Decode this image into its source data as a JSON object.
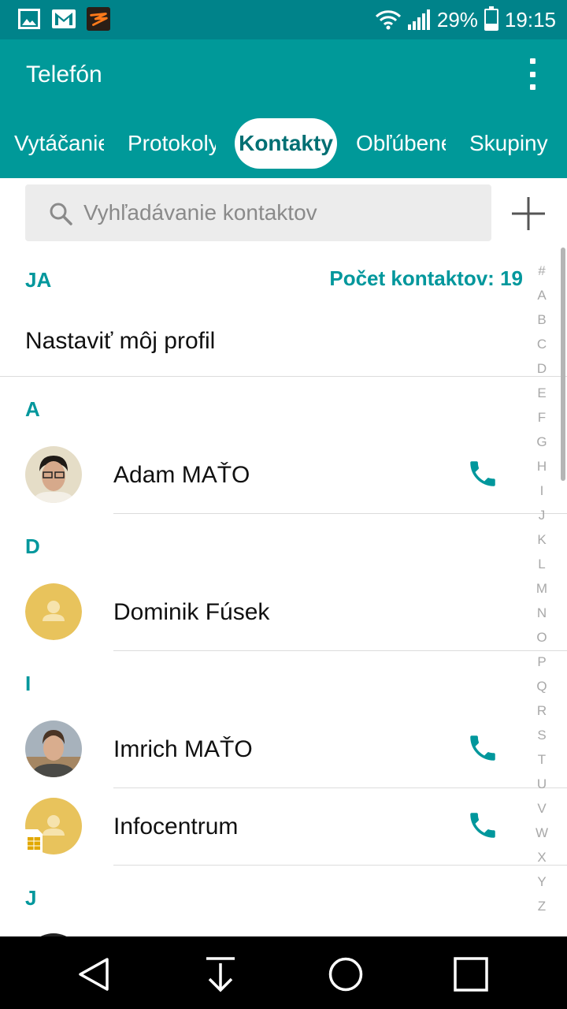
{
  "status_bar": {
    "battery_percent": "29%",
    "battery_level": 0.29,
    "time": "19:15",
    "icons": [
      "gallery-icon",
      "gmail-icon",
      "app-notification-icon",
      "wifi-icon",
      "signal-icon",
      "battery-icon"
    ]
  },
  "app_bar": {
    "title": "Telefón",
    "menu_icon": "more-vert-icon",
    "tabs": [
      {
        "label": "Vytáčanie",
        "active": false
      },
      {
        "label": "Protokoly",
        "active": false
      },
      {
        "label": "Kontakty",
        "active": true
      },
      {
        "label": "Obľúbené",
        "active": false
      },
      {
        "label": "Skupiny",
        "active": false
      }
    ]
  },
  "search": {
    "placeholder": "Vyhľadávanie kontaktov",
    "value": ""
  },
  "list": {
    "me_header": "JA",
    "contact_count": "Počet kontaktov: 19",
    "profile_label": "Nastaviť môj profil",
    "sections": [
      {
        "letter": "A",
        "contacts": [
          {
            "name": "Adam MAŤO",
            "avatar": "photo",
            "call": true
          }
        ]
      },
      {
        "letter": "D",
        "contacts": [
          {
            "name": "Dominik Fúsek",
            "avatar": "default",
            "call": false
          }
        ]
      },
      {
        "letter": "I",
        "contacts": [
          {
            "name": "Imrich MAŤO",
            "avatar": "photo",
            "call": true
          },
          {
            "name": "Infocentrum",
            "avatar": "default-sim",
            "call": true
          }
        ]
      },
      {
        "letter": "J",
        "contacts": []
      }
    ],
    "index_letters": [
      "#",
      "A",
      "B",
      "C",
      "D",
      "E",
      "F",
      "G",
      "H",
      "I",
      "J",
      "K",
      "L",
      "M",
      "N",
      "O",
      "P",
      "Q",
      "R",
      "S",
      "T",
      "U",
      "V",
      "W",
      "X",
      "Y",
      "Z"
    ]
  },
  "colors": {
    "status_bar": "#00838a",
    "app_bar": "#009999",
    "accent": "#00979c",
    "avatar_default": "#e8c35c",
    "navbar": "#000000"
  },
  "nav_bar": [
    "back-icon",
    "download-icon",
    "home-icon",
    "recents-icon"
  ]
}
